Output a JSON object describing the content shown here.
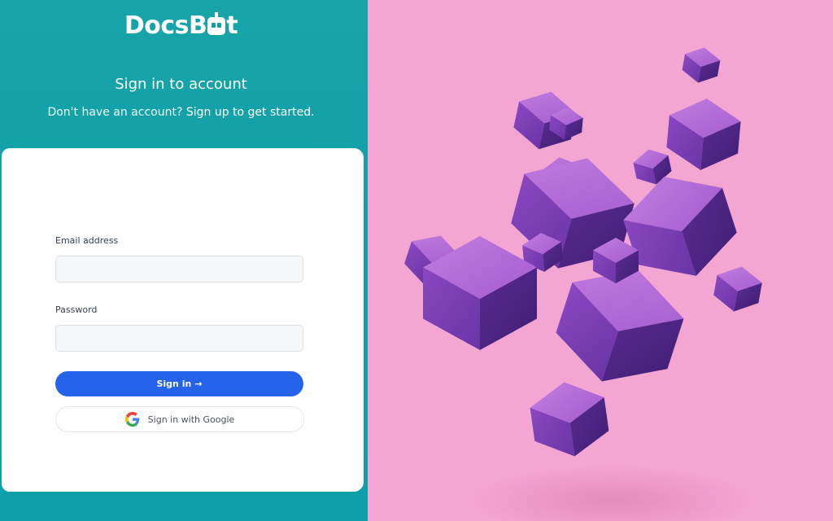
{
  "brand": {
    "logo_prefix": "DocsB",
    "logo_suffix": "t"
  },
  "auth": {
    "heading": "Sign in to account",
    "subheading_prefix": "Don't have an account?",
    "signup_link": "Sign up to get started."
  },
  "form": {
    "email_label": "Email address",
    "email_value": "",
    "password_label": "Password",
    "password_value": "",
    "signin_label": "Sign in",
    "signin_arrow": "→",
    "google_label": "Sign in with Google"
  },
  "colors": {
    "primary": "#2563eb",
    "teal": "#14a0a6",
    "pink": "#f4a6d3",
    "cube_purple": "#7b3fb0"
  },
  "illustration": {
    "name": "floating-purple-cubes"
  }
}
